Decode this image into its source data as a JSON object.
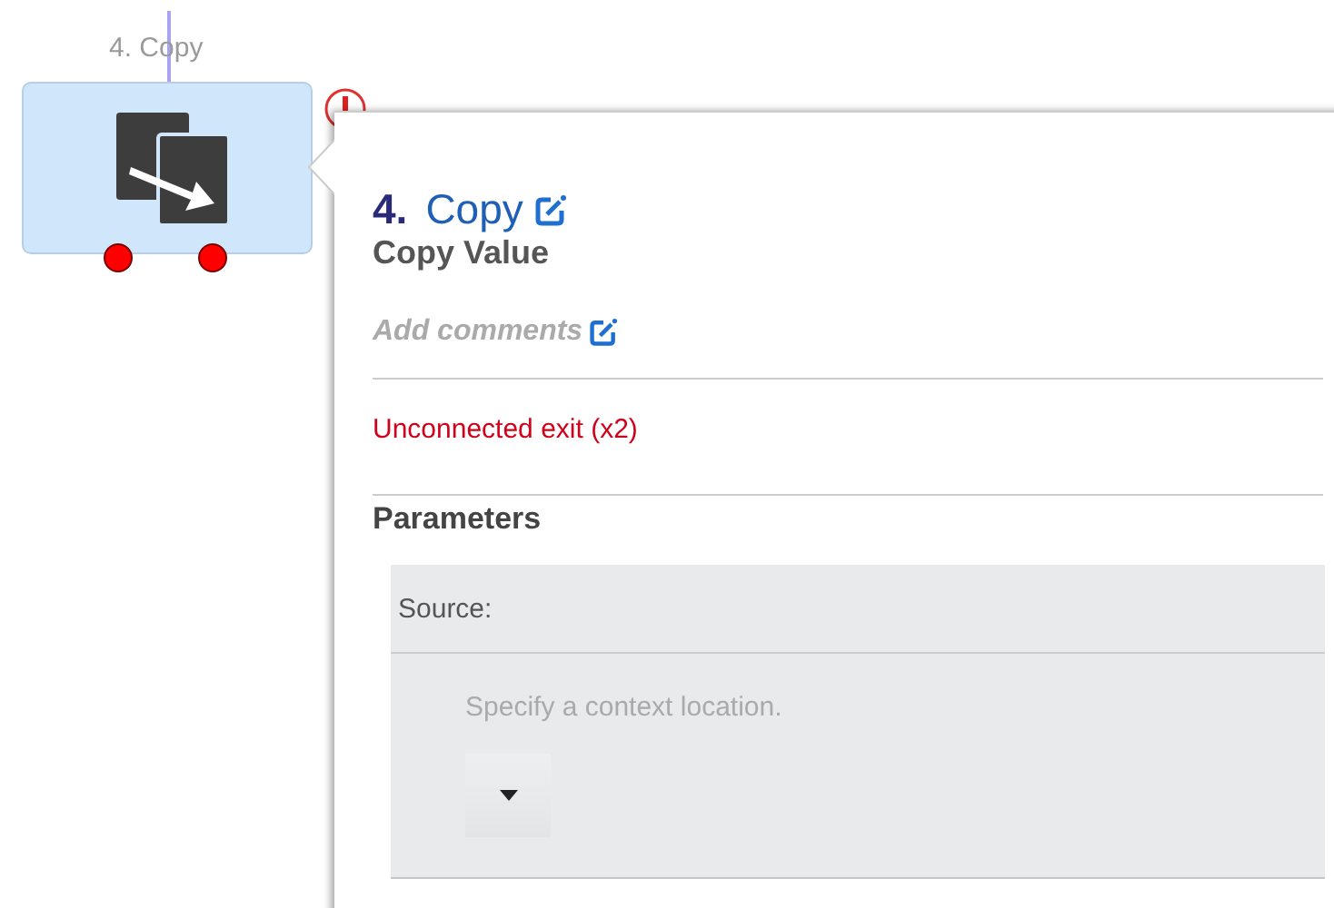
{
  "node": {
    "label": "4. Copy",
    "warning": true,
    "exits": [
      {
        "connected": false
      },
      {
        "connected": false
      }
    ]
  },
  "popover": {
    "number": "4.",
    "title": "Copy",
    "subtitle": "Copy Value",
    "comments_placeholder": "Add comments",
    "warning": "Unconnected exit (x2)",
    "section": "Parameters",
    "parameters": [
      {
        "label": "Source:",
        "hint": "Specify a context location."
      }
    ]
  }
}
